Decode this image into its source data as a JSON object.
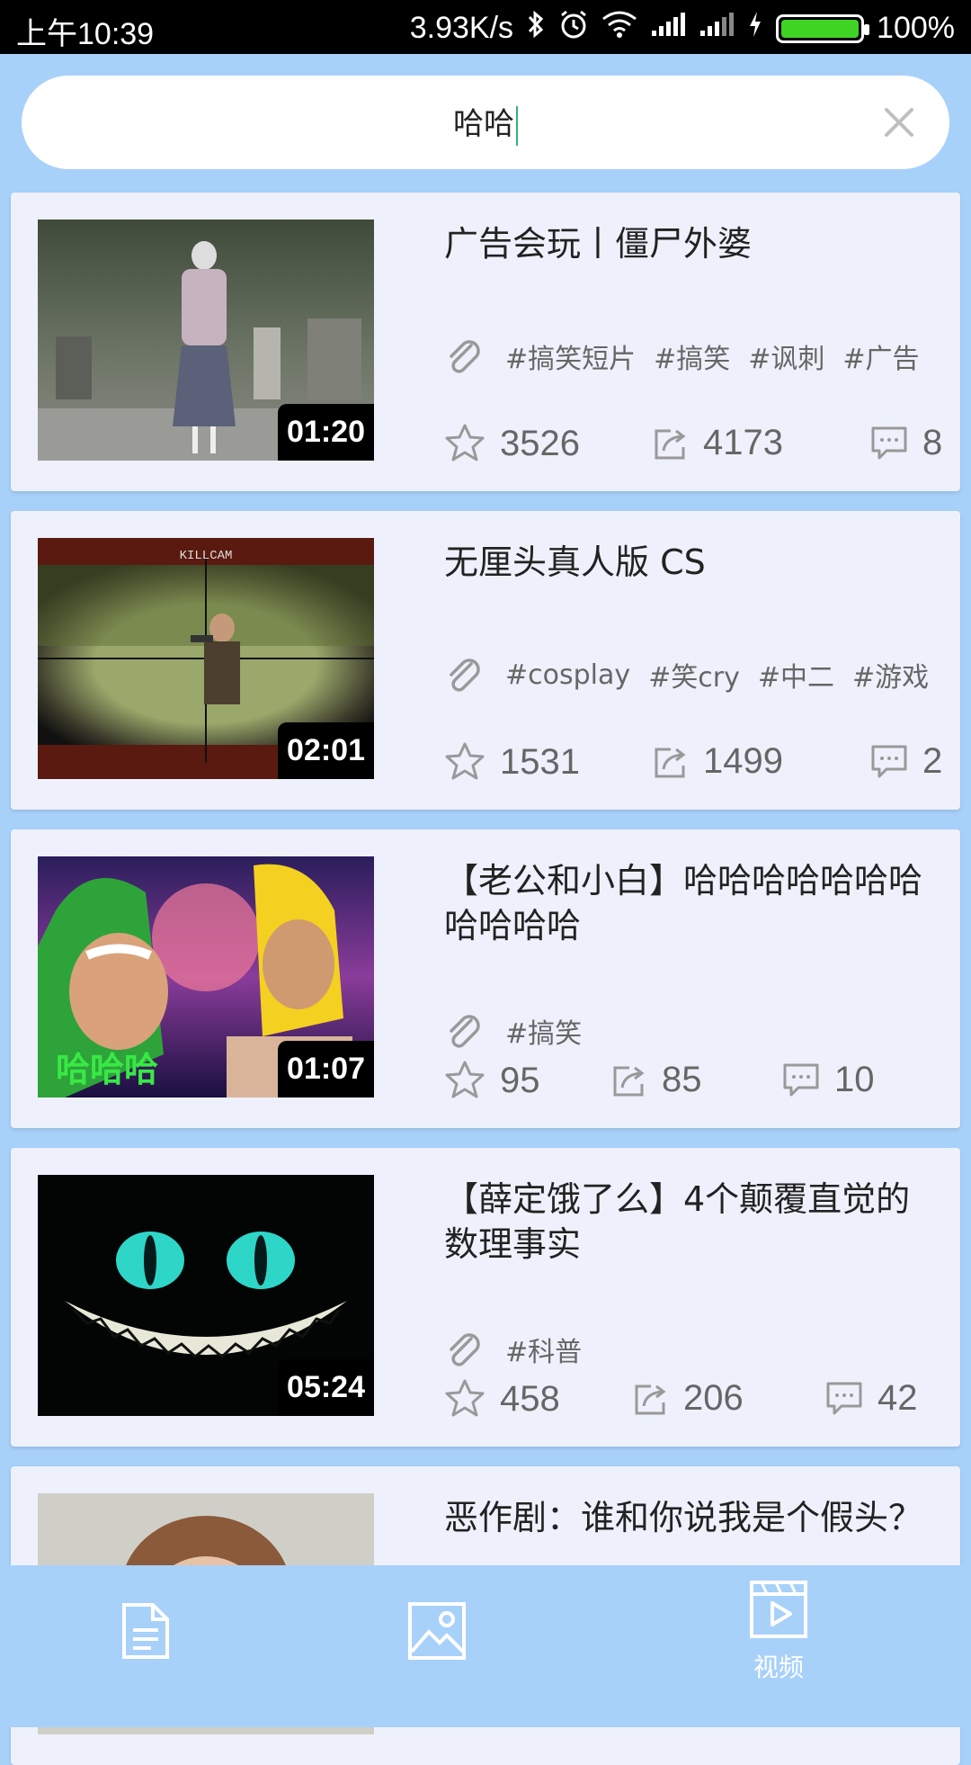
{
  "status": {
    "time": "上午10:39",
    "speed": "3.93K/s",
    "battery": "100%"
  },
  "search": {
    "value": "哈哈"
  },
  "videos": [
    {
      "title": "广告会玩丨僵尸外婆",
      "duration": "01:20",
      "tags": [
        "#搞笑短片",
        "#搞笑",
        "#讽刺",
        "#广告"
      ],
      "likes": "3526",
      "shares": "4173",
      "comments": "8"
    },
    {
      "title": "无厘头真人版 CS",
      "duration": "02:01",
      "tags": [
        "#cosplay",
        "#笑cry",
        "#中二",
        "#游戏"
      ],
      "likes": "1531",
      "shares": "1499",
      "comments": "2"
    },
    {
      "title": "【老公和小白】哈哈哈哈哈哈哈哈哈哈哈",
      "duration": "01:07",
      "tags": [
        "#搞笑"
      ],
      "likes": "95",
      "shares": "85",
      "comments": "10"
    },
    {
      "title": "【薛定饿了么】4个颠覆直觉的数理事实",
      "duration": "05:24",
      "tags": [
        "#科普"
      ],
      "likes": "458",
      "shares": "206",
      "comments": "42"
    },
    {
      "title": "恶作剧：谁和你说我是个假头？"
    }
  ],
  "nav": {
    "items": [
      {
        "icon": "document-icon"
      },
      {
        "icon": "image-icon"
      },
      {
        "icon": "video-icon",
        "label": "视频"
      }
    ]
  },
  "colors": {
    "background": "#a8d1fa",
    "card": "#eef1fb",
    "caret": "#2fb573",
    "battery": "#3fd324"
  }
}
